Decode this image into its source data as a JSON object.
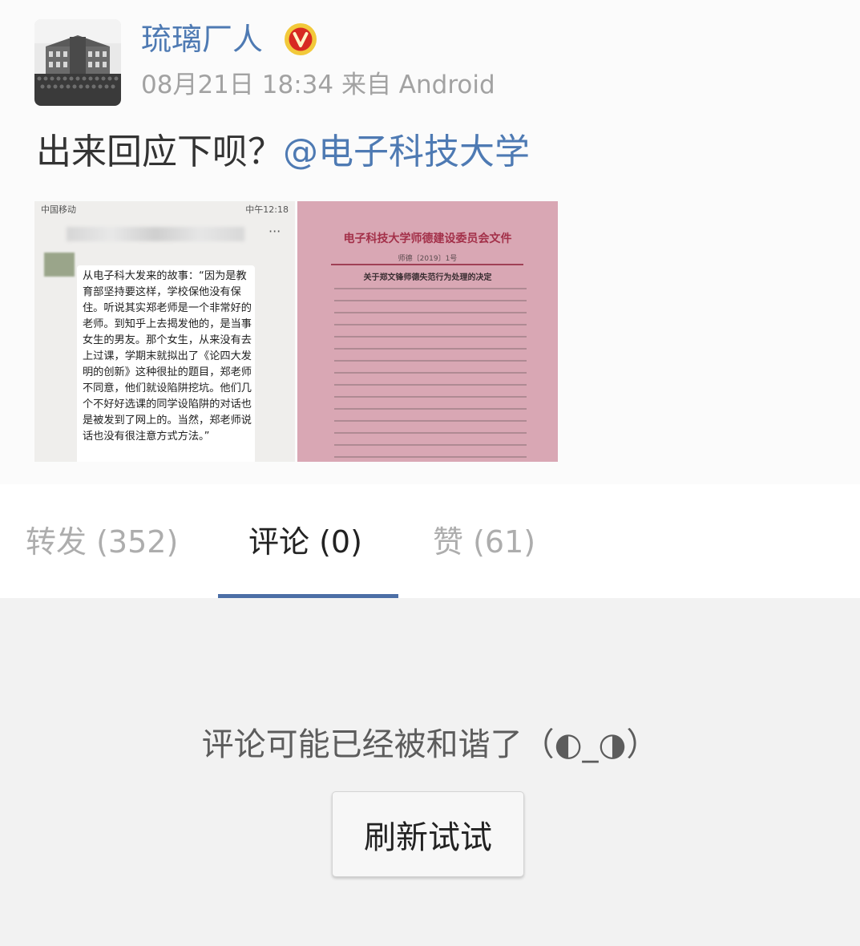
{
  "post": {
    "user_name": "琉璃厂人",
    "verified_badge_icon": "verified-v-icon",
    "accent_color": "#4e7ab3",
    "timestamp": "08月21日 18:34",
    "source": "来自 Android",
    "text": "出来回应下呗？",
    "mention": "@电子科技大学",
    "images": [
      {
        "statusbar_left": "中国移动",
        "statusbar_right": "中午12:18",
        "more": "···",
        "chat_text": "从电子科大发来的故事：“因为是教育部坚持要这样，学校保他没有保住。听说其实郑老师是一个非常好的老师。到知乎上去揭发他的，是当事女生的男友。那个女生，从来没有去上过课，学期末就拟出了《论四大发明的创新》这种很扯的题目，郑老师不同意，他们就设陷阱挖坑。他们几个不好好选课的同学设陷阱的对话也是被发到了网上的。当然，郑老师说话也没有很注意方式方法。”"
      },
      {
        "doc_title": "电子科技大学师德建设委员会文件",
        "doc_number": "师德〔2019〕1号",
        "doc_subtitle": "关于郑文锋师德失范行为处理的决定"
      }
    ]
  },
  "tabs": [
    {
      "label": "转发",
      "count": "(352)",
      "active": false
    },
    {
      "label": "评论",
      "count": "(0)",
      "active": true
    },
    {
      "label": "赞",
      "count": "(61)",
      "active": false
    }
  ],
  "tab_indicator_color": "#4c6fa6",
  "empty_state": {
    "message": "评论可能已经被和谐了（◐_◑）",
    "refresh_label": "刷新试试"
  }
}
